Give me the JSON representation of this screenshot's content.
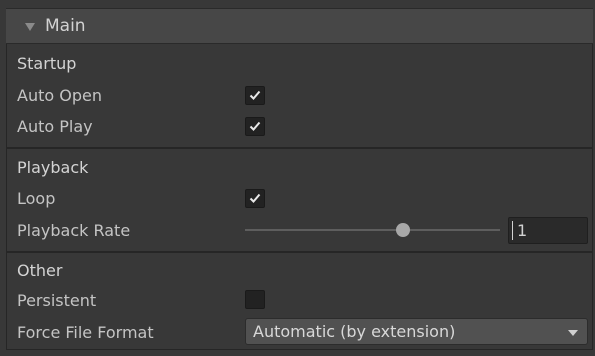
{
  "header": {
    "title": "Main",
    "expanded": true
  },
  "sections": {
    "startup": {
      "label": "Startup",
      "auto_open": {
        "label": "Auto Open",
        "checked": true
      },
      "auto_play": {
        "label": "Auto Play",
        "checked": true
      }
    },
    "playback": {
      "label": "Playback",
      "loop": {
        "label": "Loop",
        "checked": true
      },
      "playback_rate": {
        "label": "Playback Rate",
        "value": "1",
        "slider_fraction": 0.6
      }
    },
    "other": {
      "label": "Other",
      "persistent": {
        "label": "Persistent",
        "checked": false
      },
      "force_file_format": {
        "label": "Force File Format",
        "selected": "Automatic (by extension)"
      }
    }
  },
  "colors": {
    "background": "#383838",
    "header": "#474747",
    "checkbox": "#222222",
    "dropdown": "#515151"
  }
}
